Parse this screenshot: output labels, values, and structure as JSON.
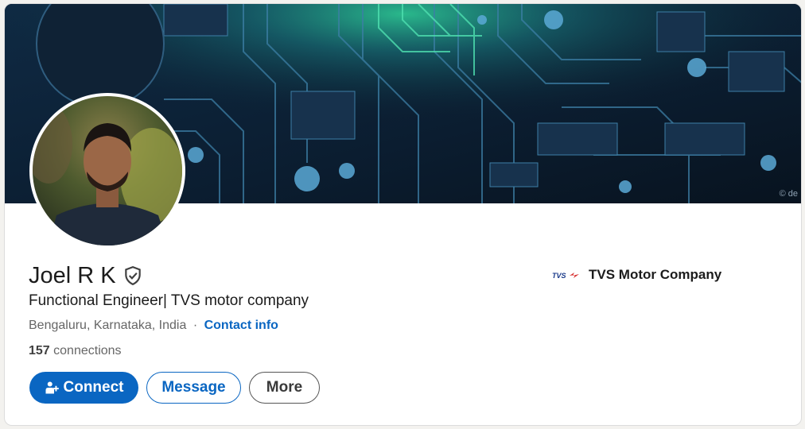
{
  "profile": {
    "name": "Joel R K",
    "headline": "Functional Engineer| TVS motor company",
    "location": "Bengaluru, Karnataka, India",
    "location_sep": "·",
    "contact_label": "Contact info",
    "connections_count": "157",
    "connections_label": "connections"
  },
  "actions": {
    "connect_label": "Connect",
    "message_label": "Message",
    "more_label": "More"
  },
  "company": {
    "name": "TVS Motor Company",
    "logo_text": "TVS"
  },
  "banner": {
    "watermark": "© de"
  },
  "colors": {
    "accent": "#0a66c2",
    "banner_base": "#0b1c2c",
    "circuit_glow": "#3fd0a0"
  },
  "icons": {
    "verified": "shield-check-icon",
    "connect": "add-person-icon"
  }
}
